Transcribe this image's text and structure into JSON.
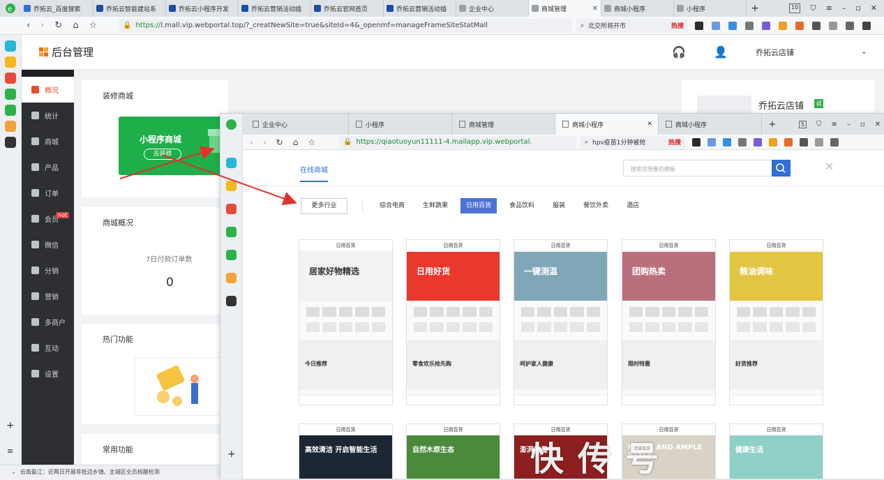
{
  "browser": {
    "tabs": [
      {
        "label": "乔拓云_百度搜索",
        "color": "#2e6fd8"
      },
      {
        "label": "乔拓云智能建站系",
        "color": "#1a4fa0"
      },
      {
        "label": "乔拓云小程序开发",
        "color": "#1a4fa0"
      },
      {
        "label": "乔拓云营销活动插",
        "color": "#1a4fa0"
      },
      {
        "label": "乔拓云官网首页",
        "color": "#1a4fa0"
      },
      {
        "label": "乔拓云营销活动插",
        "color": "#1a4fa0"
      },
      {
        "label": "企业中心",
        "color": "#9aa0a6"
      },
      {
        "label": "商城管理",
        "color": "#9aa0a6"
      },
      {
        "label": "商城小程序",
        "color": "#9aa0a6"
      },
      {
        "label": "小程序",
        "color": "#9aa0a6"
      }
    ],
    "tab_count": "10",
    "url_prefix": "https://",
    "url_host": "l.mall.vip.webportal.top",
    "url_path": "/?_creatNewSite=true&siteId=4&_openmf=manageFrameSiteStatMall",
    "search_text": "北交所将开市",
    "search_hot": "热搜"
  },
  "admin": {
    "title": "后台管理",
    "shop_name": "乔拓云店铺",
    "menu": [
      {
        "label": "概况"
      },
      {
        "label": "统计"
      },
      {
        "label": "商城"
      },
      {
        "label": "产品"
      },
      {
        "label": "订单"
      },
      {
        "label": "会员"
      },
      {
        "label": "微信"
      },
      {
        "label": "分销"
      },
      {
        "label": "营销"
      },
      {
        "label": "多商户"
      },
      {
        "label": "互动"
      },
      {
        "label": "设置"
      }
    ],
    "hot_badge": "hot",
    "decorate_title": "装修商城",
    "mp_mall_label": "小程序商城",
    "go_decorate": "去装修",
    "overview_title": "商城概况",
    "orders_label": "7日付款订单数",
    "orders_value": "0",
    "hot_func_title": "热门功能",
    "common_func_title": "常用功能",
    "store_card_name": "乔拓云店铺",
    "store_badge": "试"
  },
  "status_text": "云南盈江：近两日开展非抵边乡镇、主城区全员核酸检测",
  "popup": {
    "tabs": [
      {
        "label": "企业中心"
      },
      {
        "label": "小程序"
      },
      {
        "label": "商城管理"
      },
      {
        "label": "商城小程序"
      },
      {
        "label": "商城小程序"
      }
    ],
    "tab_count": "5",
    "url_prefix": "https://",
    "url_host": "qiaotuoyun11111-4.mallapp.vip.webportal.",
    "search_text": "hpv疫苗1分钟被抢",
    "search_hot": "热搜",
    "online_mall": "在线商城",
    "search_placeholder": "搜索您想要的模板",
    "more_industry": "更多行业",
    "categories": [
      "综合电商",
      "生鲜蔬果",
      "日用百货",
      "食品饮料",
      "服装",
      "餐饮外卖",
      "酒店"
    ],
    "selected_category": "日用百货",
    "templates_row1": [
      {
        "header": "日用百货",
        "banner_text": "居家好物精选",
        "sub_text": "今日推荐",
        "banner_color": "#f2f2f2"
      },
      {
        "header": "日用百货",
        "banner_text": "日用好货",
        "sub_text": "零食欢乐抢先购",
        "banner_color": "#e9382c"
      },
      {
        "header": "日用百货",
        "banner_text": "一键测温",
        "sub_text": "呵护家人健康",
        "banner_color": "#7fa7b8"
      },
      {
        "header": "日用百货",
        "banner_text": "团购热卖",
        "sub_text": "限时特惠",
        "banner_color": "#b9707c"
      },
      {
        "header": "日用百货",
        "banner_text": "粮油调味",
        "sub_text": "好货推荐",
        "banner_color": "#e3c544"
      }
    ],
    "templates_row2": [
      {
        "header": "日用百货",
        "banner_text": "高效清洁 开启智能生活",
        "banner_color": "#1d2633"
      },
      {
        "header": "日用百货",
        "banner_text": "自然木原生态",
        "banner_color": "#4a8a3a"
      },
      {
        "header": "日用百货",
        "banner_text": "澎湃能量",
        "banner_color": "#8c1f1f"
      },
      {
        "header": "日用百货",
        "banner_text": "HOTEL AND AMPLE STYLE",
        "banner_color": "#d9d2c7"
      },
      {
        "header": "日用百货",
        "banner_text": "健康生活",
        "banner_color": "#8fd1c6"
      }
    ]
  },
  "watermark": "快传号"
}
